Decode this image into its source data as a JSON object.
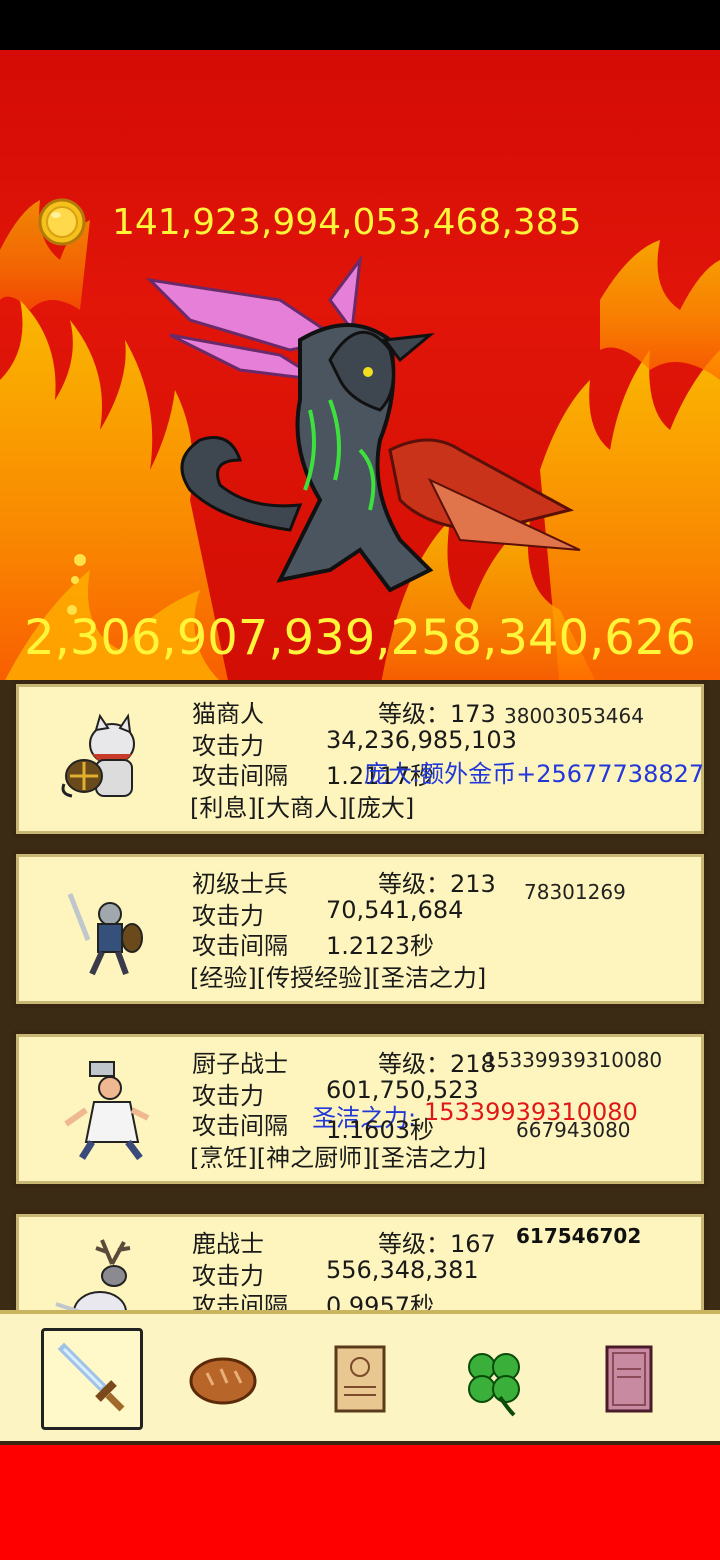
{
  "gold": {
    "amount": "141,923,994,053,468,385",
    "icon": "gold-coin-icon"
  },
  "monster": {
    "hp": "2,306,907,939,258,340,626",
    "icon": "winged-dragon-monster"
  },
  "heroes": [
    {
      "name": "猫商人",
      "level_text": "等级：173",
      "attack_label": "攻击力",
      "attack_value": "34,236,985,103",
      "interval_label": "攻击间隔",
      "interval_value": "1.2117秒",
      "tags": "[利息][大商人][庞大]",
      "float_number": "38003053464",
      "bonus_text": "庞大:额外金币+25677738827",
      "icon": "cat-merchant-icon"
    },
    {
      "name": "初级士兵",
      "level_text": "等级：213",
      "attack_label": "攻击力",
      "attack_value": "70,541,684",
      "interval_label": "攻击间隔",
      "interval_value": "1.2123秒",
      "tags": "[经验][传授经验][圣洁之力]",
      "float_number": "78301269",
      "icon": "soldier-icon"
    },
    {
      "name": "厨子战士",
      "level_text": "等级：218",
      "attack_label": "攻击力",
      "attack_value": "601,750,523",
      "interval_label": "攻击间隔",
      "interval_value": "1.1603秒",
      "tags": "[烹饪][神之厨师][圣洁之力]",
      "float_number_top": "15339939310080",
      "float_number_bottom": "667943080",
      "holy_label": "圣洁之力:",
      "holy_value": "15339939310080",
      "icon": "chef-warrior-icon"
    },
    {
      "name": "鹿战士",
      "level_text": "等级：167",
      "attack_label": "攻击力",
      "attack_value": "556,348,381",
      "interval_label": "攻击间隔",
      "interval_value": "0.9957秒",
      "float_number": "617546702",
      "icon": "deer-warrior-icon"
    }
  ],
  "nav": [
    {
      "name": "sword",
      "icon": "sword-icon",
      "active": true
    },
    {
      "name": "bread",
      "icon": "bread-icon",
      "active": false
    },
    {
      "name": "scroll",
      "icon": "scroll-icon",
      "active": false
    },
    {
      "name": "clover",
      "icon": "clover-icon",
      "active": false
    },
    {
      "name": "book",
      "icon": "book-icon",
      "active": false
    }
  ],
  "colors": {
    "gold_text": "#fff53a",
    "card_bg": "#fdf5bd",
    "background_red": "#fe0000",
    "bonus_blue": "#2238d8",
    "holy_red": "#e01818"
  }
}
